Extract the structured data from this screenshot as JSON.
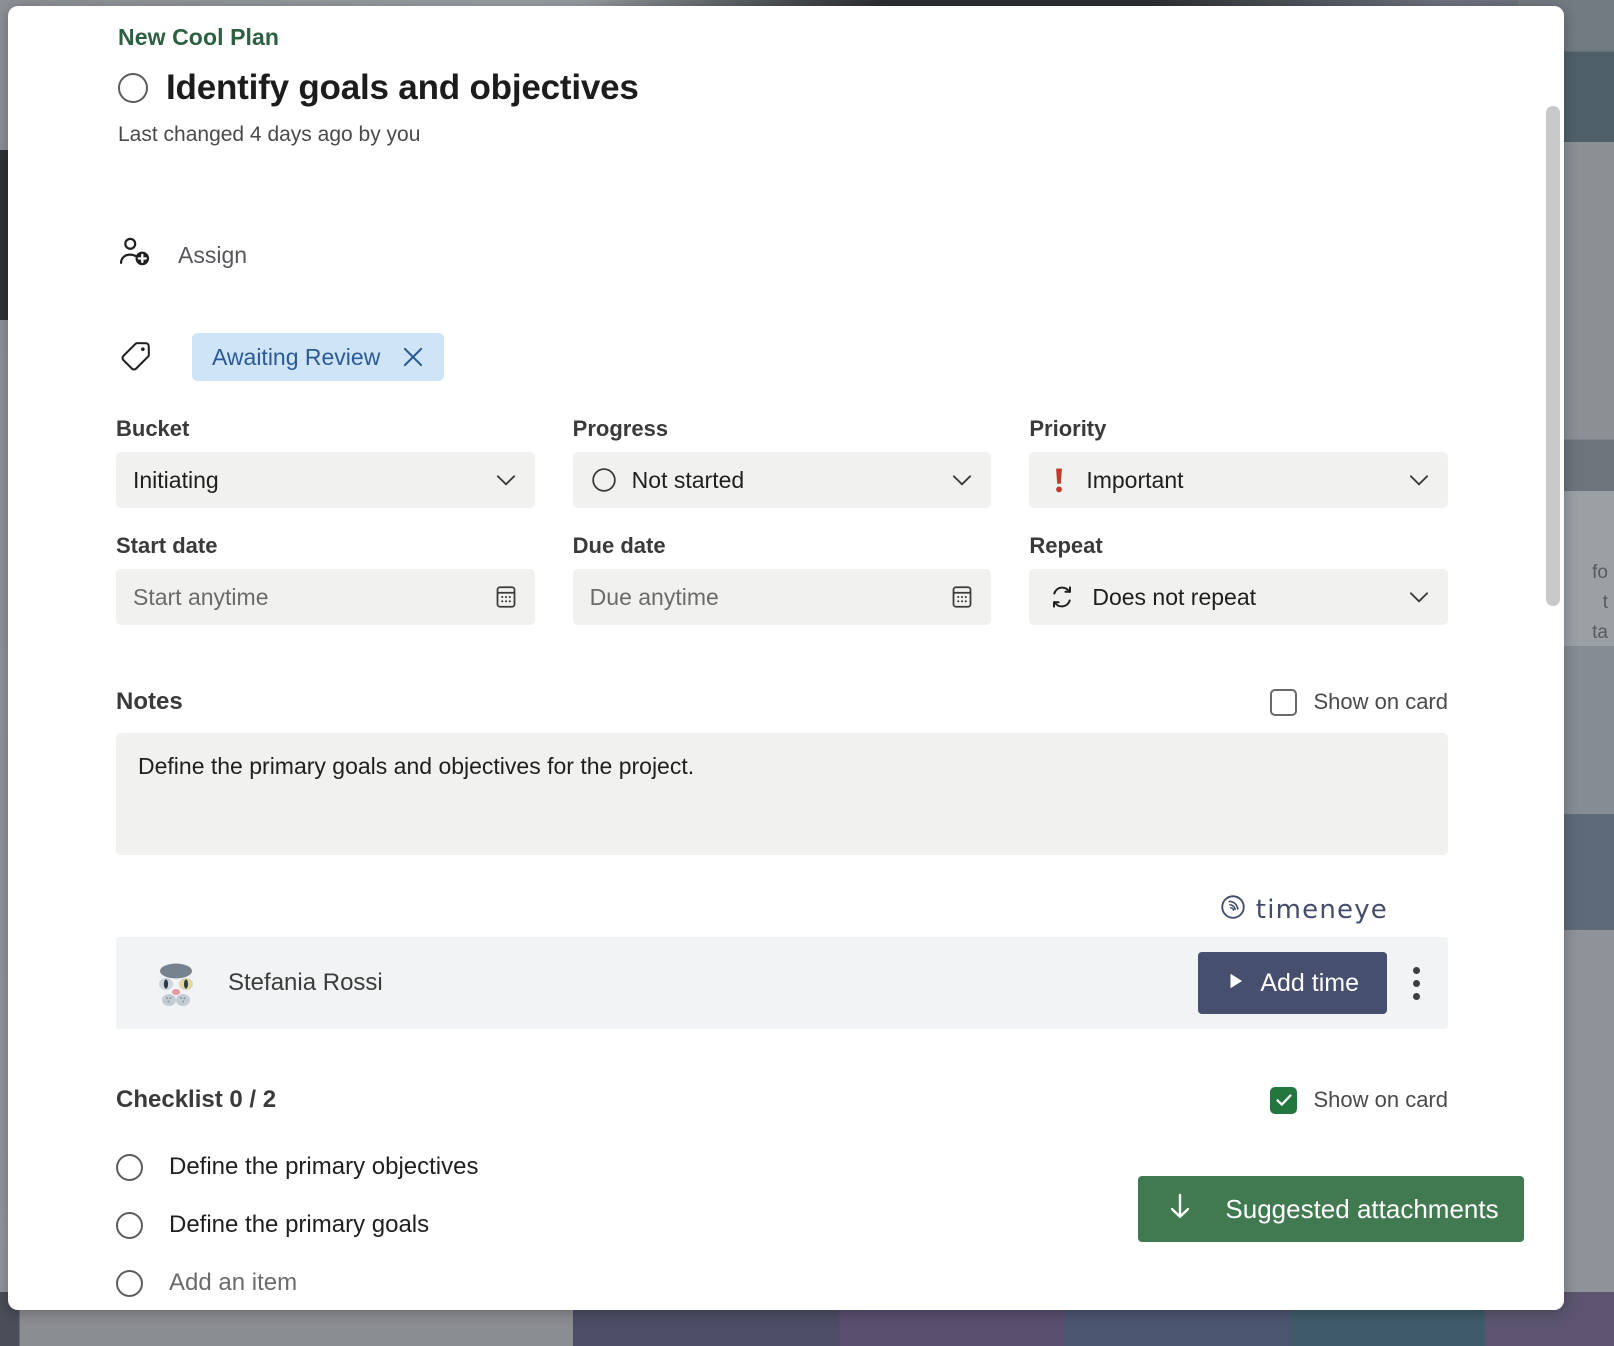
{
  "header": {
    "plan_name": "New Cool Plan",
    "task_title": "Identify goals and objectives",
    "last_changed": "Last changed 4 days ago by you"
  },
  "assign": {
    "label": "Assign",
    "icon": "person-add-icon"
  },
  "labels": {
    "tag_icon": "tag-icon",
    "chip_text": "Awaiting Review",
    "chip_remove_icon": "close-icon"
  },
  "fields": {
    "bucket": {
      "label": "Bucket",
      "value": "Initiating",
      "chevron_icon": "chevron-down-icon"
    },
    "progress": {
      "label": "Progress",
      "value": "Not started",
      "status_icon": "not-started-circle-icon",
      "chevron_icon": "chevron-down-icon"
    },
    "priority": {
      "label": "Priority",
      "value": "Important",
      "priority_icon": "exclamation-important-icon",
      "priority_color": "#c0392b",
      "chevron_icon": "chevron-down-icon"
    },
    "start_date": {
      "label": "Start date",
      "placeholder": "Start anytime",
      "value": "",
      "calendar_icon": "calendar-icon"
    },
    "due_date": {
      "label": "Due date",
      "placeholder": "Due anytime",
      "value": "",
      "calendar_icon": "calendar-icon"
    },
    "repeat": {
      "label": "Repeat",
      "value": "Does not repeat",
      "repeat_icon": "repeat-icon",
      "chevron_icon": "chevron-down-icon"
    }
  },
  "notes": {
    "title": "Notes",
    "text": "Define the primary goals and objectives for the project.",
    "show_on_card_label": "Show on card",
    "show_on_card_checked": false
  },
  "timeneye": {
    "brand": "timeneye",
    "brand_color": "#434c6b",
    "person_name": "Stefania Rossi",
    "avatar_icon": "cat-avatar-icon",
    "add_time_label": "Add time",
    "play_icon": "play-icon",
    "more_icon": "kebab-menu-icon"
  },
  "checklist": {
    "title": "Checklist 0 / 2",
    "show_on_card_label": "Show on card",
    "show_on_card_checked": true,
    "items": [
      {
        "text": "Define the primary objectives",
        "checked": false
      },
      {
        "text": "Define the primary goals",
        "checked": false
      }
    ],
    "add_item_placeholder": "Add an item"
  },
  "suggested": {
    "label": "Suggested attachments",
    "icon": "arrow-down-icon",
    "color": "#417a50"
  },
  "background": {
    "side_text_lines": [
      "fo",
      "t",
      "ta"
    ]
  }
}
